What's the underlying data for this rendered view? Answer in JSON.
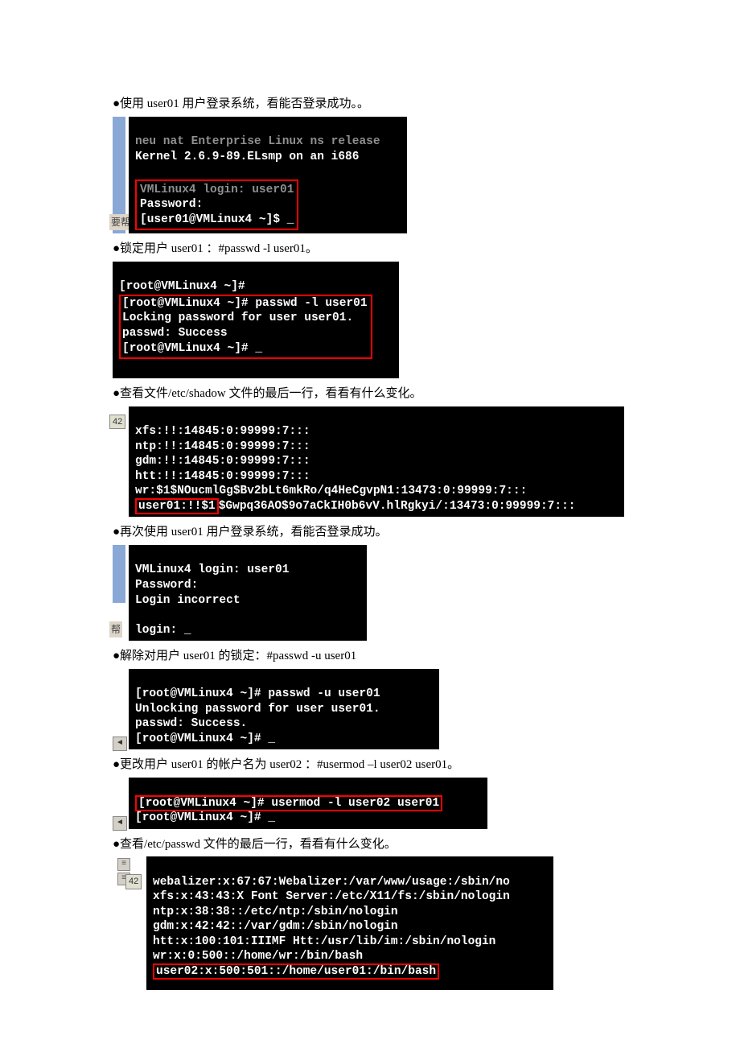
{
  "step1": {
    "instruction": "●使用 user01 用户登录系统，看能否登录成功。。",
    "term_gray_line": "neu nat Enterprise Linux ns release",
    "term_line_kernel": "Kernel 2.6.9-89.ELsmp on an i686",
    "term_login": "VMLinux4 login: user01",
    "term_passline": "Password:",
    "term_prompt": "[user01@VMLinux4 ~]$ _",
    "sidebar_label": "要帮"
  },
  "step2": {
    "instruction": "●锁定用户 user01 ：#passwd    -l user01。",
    "line0": "[root@VMLinux4 ~]#",
    "line1": "[root@VMLinux4 ~]# passwd -l user01",
    "line2": "Locking password for user user01.",
    "line3": "passwd: Success",
    "line4": "[root@VMLinux4 ~]# _"
  },
  "step3": {
    "instruction": "●查看文件/etc/shadow 文件的最后一行，看看有什么变化。",
    "sidebar_num": "42",
    "line0": "xfs:!!:14845:0:99999:7:::",
    "line1": "ntp:!!:14845:0:99999:7:::",
    "line2": "gdm:!!:14845:0:99999:7:::",
    "line3": "htt:!!:14845:0:99999:7:::",
    "line4": "wr:$1$NOucmlGg$Bv2bLt6mkRo/q4HeCgvpN1:13473:0:99999:7:::",
    "line5_boxed": "user01:!!$1",
    "line5_rest": "$Gwpq36AO$9o7aCkIH0b6vV.hlRgkyi/:13473:0:99999:7:::"
  },
  "step4": {
    "instruction": "●再次使用 user01 用户登录系统，看能否登录成功。",
    "line0": "VMLinux4 login: user01",
    "line1": "Password:",
    "line2": "Login incorrect",
    "line3": "",
    "line4": "login: _",
    "sidebar_label": "帮"
  },
  "step5": {
    "instruction": "●解除对用户 user01 的锁定：#passwd       -u user01",
    "line1": "[root@VMLinux4 ~]# passwd -u user01",
    "line2": "Unlocking password for user user01.",
    "line3": "passwd: Success.",
    "line4": "[root@VMLinux4 ~]# _"
  },
  "step6": {
    "instruction": "●更改用户 user01 的帐户名为 user02 ：#usermod –l user02 user01。",
    "line1_boxed": "[root@VMLinux4 ~]# usermod -l user02 user01",
    "line2": "[root@VMLinux4 ~]# _"
  },
  "step7": {
    "instruction": "●查看/etc/passwd 文件的最后一行，看看有什么变化。",
    "sidebar_num": "42",
    "line0": "webalizer:x:67:67:Webalizer:/var/www/usage:/sbin/no",
    "line1": "xfs:x:43:43:X Font Server:/etc/X11/fs:/sbin/nologin",
    "line2": "ntp:x:38:38::/etc/ntp:/sbin/nologin",
    "line3": "gdm:x:42:42::/var/gdm:/sbin/nologin",
    "line4": "htt:x:100:101:IIIMF Htt:/usr/lib/im:/sbin/nologin",
    "line5": "wr:x:0:500::/home/wr:/bin/bash",
    "line6_boxed": "user02:x:500:501::/home/user01:/bin/bash"
  }
}
